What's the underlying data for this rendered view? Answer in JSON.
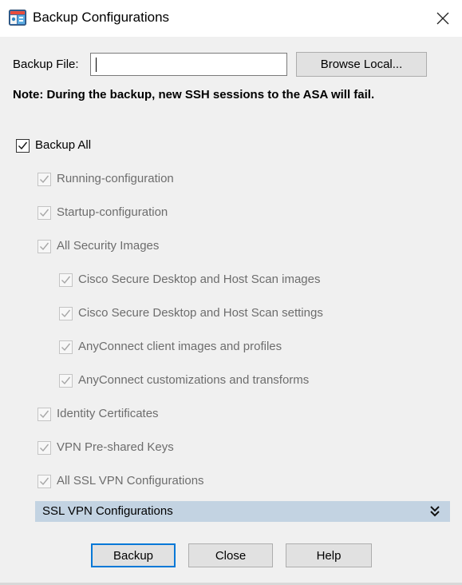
{
  "window": {
    "title": "Backup Configurations",
    "icon": "asdm-app-icon",
    "close_icon": "close-icon"
  },
  "backup_file": {
    "label": "Backup File:",
    "value": "",
    "browse_label": "Browse Local..."
  },
  "note": "Note: During the backup, new SSH sessions to the ASA will fail.",
  "backup_all": {
    "label": "Backup All",
    "checked": true
  },
  "options": [
    {
      "label": "Running-configuration",
      "checked": true,
      "enabled": false
    },
    {
      "label": "Startup-configuration",
      "checked": true,
      "enabled": false
    },
    {
      "label": "All Security Images",
      "checked": true,
      "enabled": false
    },
    {
      "label": "Cisco Secure Desktop and Host Scan images",
      "checked": true,
      "enabled": false
    },
    {
      "label": "Cisco Secure Desktop and Host Scan settings",
      "checked": true,
      "enabled": false
    },
    {
      "label": "AnyConnect client images and profiles",
      "checked": true,
      "enabled": false
    },
    {
      "label": "AnyConnect customizations and transforms",
      "checked": true,
      "enabled": false
    },
    {
      "label": "Identity Certificates",
      "checked": true,
      "enabled": false
    },
    {
      "label": "VPN Pre-shared Keys",
      "checked": true,
      "enabled": false
    },
    {
      "label": "All SSL VPN Configurations",
      "checked": true,
      "enabled": false
    }
  ],
  "ssl_section": {
    "label": "SSL VPN Configurations",
    "icon": "double-chevron-down-icon"
  },
  "buttons": {
    "backup": "Backup",
    "close": "Close",
    "help": "Help"
  },
  "colors": {
    "dialog_bg": "#f0f0f0",
    "section_bar": "#c3d3e2",
    "default_button_border": "#0078d7",
    "disabled_text": "#6d6d6d"
  }
}
